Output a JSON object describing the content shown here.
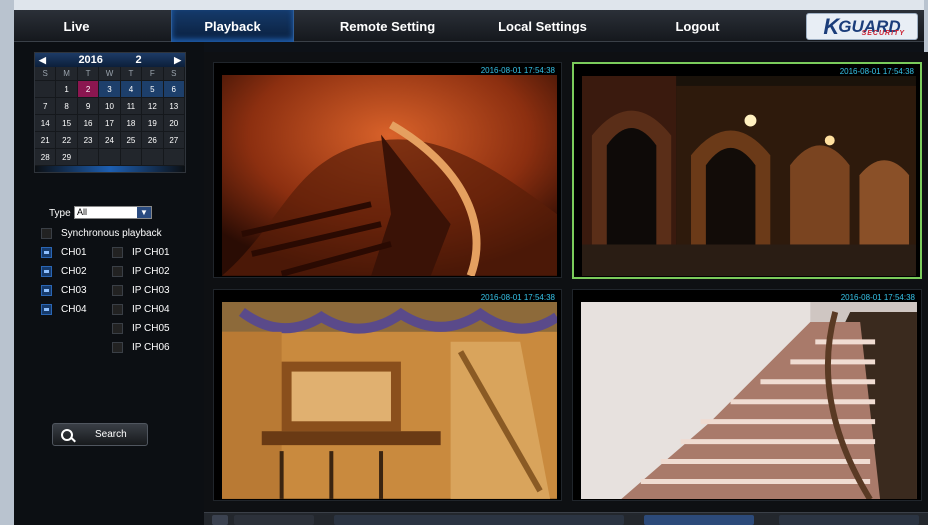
{
  "nav": {
    "live": "Live",
    "playback": "Playback",
    "remote_setting": "Remote Setting",
    "local_settings": "Local Settings",
    "logout": "Logout"
  },
  "logo": {
    "k": "K",
    "g": "GUARD",
    "sub": "SECURITY"
  },
  "calendar": {
    "year": "2016",
    "month": "2",
    "dow": [
      "S",
      "M",
      "T",
      "W",
      "T",
      "F",
      "S"
    ],
    "days": [
      "",
      "1",
      "2",
      "3",
      "4",
      "5",
      "6",
      "7",
      "8",
      "9",
      "10",
      "11",
      "12",
      "13",
      "14",
      "15",
      "16",
      "17",
      "18",
      "19",
      "20",
      "21",
      "22",
      "23",
      "24",
      "25",
      "26",
      "27",
      "28",
      "29",
      "",
      "",
      "",
      "",
      ""
    ],
    "selected_day": "2",
    "highlighted_days": [
      "3",
      "4",
      "5",
      "6"
    ]
  },
  "filters": {
    "type_label": "Type",
    "type_value": "All",
    "sync_label": "Synchronous playback"
  },
  "channels": {
    "analog": [
      {
        "label": "CH01",
        "checked": true
      },
      {
        "label": "CH02",
        "checked": true
      },
      {
        "label": "CH03",
        "checked": true
      },
      {
        "label": "CH04",
        "checked": true
      }
    ],
    "ip": [
      {
        "label": "IP CH01",
        "checked": false
      },
      {
        "label": "IP CH02",
        "checked": false
      },
      {
        "label": "IP CH03",
        "checked": false
      },
      {
        "label": "IP CH04",
        "checked": false
      },
      {
        "label": "IP CH05",
        "checked": false
      },
      {
        "label": "IP CH06",
        "checked": false
      }
    ]
  },
  "search_label": "Search",
  "cameras": [
    {
      "timestamp": "2016-08-01 17:54:38",
      "scene": "spiral-staircase"
    },
    {
      "timestamp": "2016-08-01 17:54:38",
      "scene": "arcade-night"
    },
    {
      "timestamp": "2016-08-01 17:54:38",
      "scene": "log-cabin-interior"
    },
    {
      "timestamp": "2016-08-01 17:54:38",
      "scene": "curved-stairs"
    }
  ],
  "colors": {
    "active_border": "#7acb5b",
    "timestamp": "#36c3e8",
    "selected_day": "#8b1650"
  }
}
